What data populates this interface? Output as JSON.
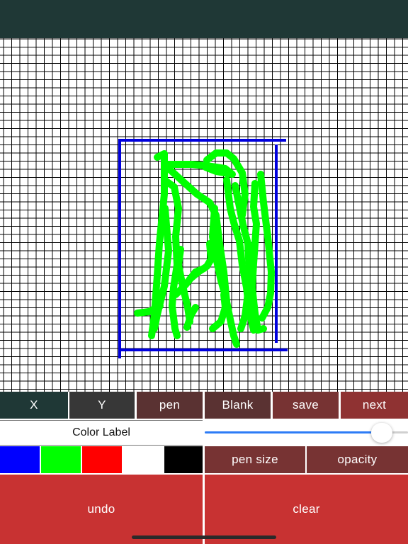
{
  "toolbar": {
    "x_label": "X",
    "y_label": "Y",
    "pen_label": "pen",
    "blank_label": "Blank",
    "save_label": "save",
    "next_label": "next"
  },
  "color_label": "Color Label",
  "slider": {
    "value": 0.87,
    "accent": "#2d7cf6"
  },
  "swatches": [
    {
      "name": "blue",
      "color": "#0000ff"
    },
    {
      "name": "green",
      "color": "#00ff00"
    },
    {
      "name": "red",
      "color": "#ff0000"
    },
    {
      "name": "white",
      "color": "#ffffff"
    },
    {
      "name": "black",
      "color": "#000000"
    }
  ],
  "pen_size_label": "pen size",
  "opacity_label": "opacity",
  "undo_label": "undo",
  "clear_label": "clear",
  "colors": {
    "topbar": "#1f3836",
    "grid_line": "#000000",
    "frame_stroke": "#0000dd",
    "sketch_stroke": "#00ff00"
  }
}
